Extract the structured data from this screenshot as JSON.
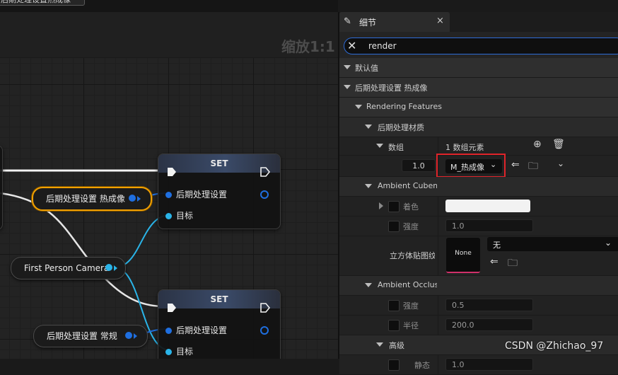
{
  "graph": {
    "top_button": "后期处理设置热成像",
    "zoom": "缩放1:1",
    "set_nodes": [
      {
        "title": "SET",
        "pin1": "后期处理设置",
        "pin2": "目标"
      },
      {
        "title": "SET",
        "pin1": "后期处理设置",
        "pin2": "目标"
      }
    ],
    "var_thermal": "后期处理设置 热成像",
    "var_camera": "First Person Camera",
    "var_normal": "后期处理设置 常规"
  },
  "details": {
    "tab_title": "细节",
    "tab_icon": "pencil-icon",
    "close": "×",
    "search_value": "render",
    "rows": {
      "default": "默认值",
      "pp_thermal": "后期处理设置 热成像",
      "rendering_features": "Rendering Features",
      "pp_materials": "后期处理材质",
      "array_label": "数组",
      "array_count": "1 数组元素",
      "element_weight": "1.0",
      "material_value": "M_热成像",
      "ambient_cubemap": "Ambient Cubemap",
      "tint": "着色",
      "intensity": "强度",
      "intensity_value": "1.0",
      "cubemap_texture": "立方体贴图纹理",
      "thumbnail_label": "None",
      "texture_value": "无",
      "ambient_occlusion": "Ambient Occlusion",
      "ao_intensity": "强度",
      "ao_intensity_value": "0.5",
      "ao_radius": "半径",
      "ao_radius_value": "200.0",
      "advanced": "高级",
      "static_fraction": "静态",
      "static_fraction_value": "1.0"
    }
  },
  "watermark": "CSDN @Zhichao_97",
  "colors": {
    "exec_wire": "#f2f2f2",
    "object_pin": "#1f6fe0",
    "component_pin": "#2ab4e8",
    "selection": "#f1a000",
    "highlight_box": "#e0242a",
    "search_border": "#2d6bd6"
  }
}
